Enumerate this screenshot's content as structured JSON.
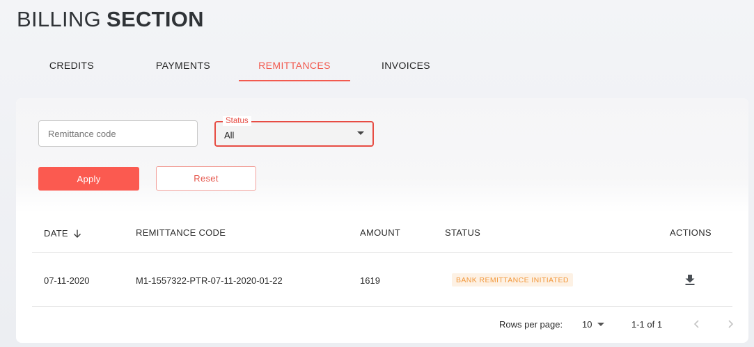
{
  "header": {
    "title_light": "BILLING",
    "title_bold": "SECTION"
  },
  "tabs": [
    {
      "label": "CREDITS",
      "active": false
    },
    {
      "label": "PAYMENTS",
      "active": false
    },
    {
      "label": "REMITTANCES",
      "active": true
    },
    {
      "label": "INVOICES",
      "active": false
    }
  ],
  "filters": {
    "code_placeholder": "Remittance code",
    "status_label": "Status",
    "status_value": "All",
    "apply_label": "Apply",
    "reset_label": "Reset"
  },
  "table": {
    "columns": [
      "DATE",
      "REMITTANCE CODE",
      "AMOUNT",
      "STATUS",
      "ACTIONS"
    ],
    "sort": {
      "column": "DATE",
      "direction": "descending"
    },
    "rows": [
      {
        "date": "07-11-2020",
        "code": "M1-1557322-PTR-07-11-2020-01-22",
        "amount": "1619",
        "status": "BANK REMITTANCE INITIATED",
        "action_icon": "download-icon"
      }
    ]
  },
  "pagination": {
    "rows_per_page_label": "Rows per page:",
    "rows_per_page": "10",
    "range": "1-1 of 1"
  },
  "colors": {
    "accent": "#f25a4f",
    "status_badge_bg": "#fdf1e4",
    "status_badge_text": "#f2973a"
  }
}
